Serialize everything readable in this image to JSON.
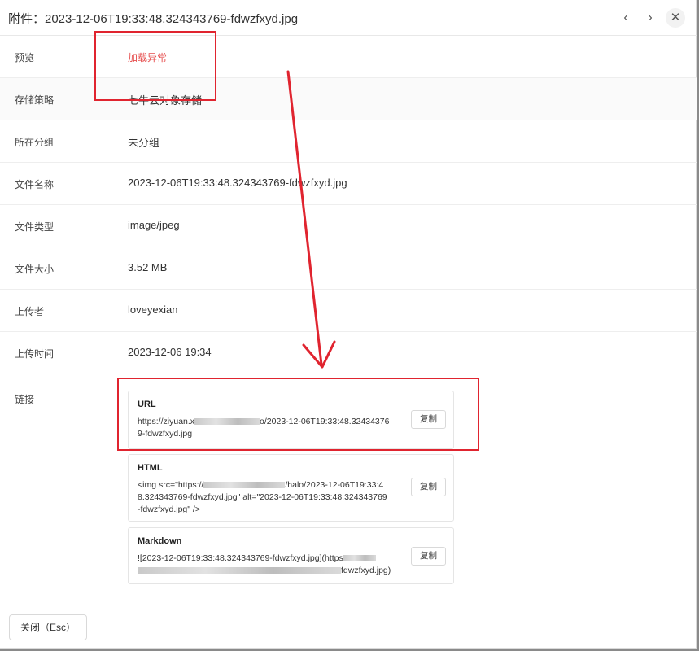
{
  "header": {
    "title": "附件：2023-12-06T19:33:48.324343769-fdwzfxyd.jpg",
    "prev_icon": "‹",
    "next_icon": "›",
    "close_icon": "✕"
  },
  "rows": [
    {
      "label": "预览",
      "value": "加载异常"
    },
    {
      "label": "存储策略",
      "value": "七牛云对象存储"
    },
    {
      "label": "所在分组",
      "value": "未分组"
    },
    {
      "label": "文件名称",
      "value": "2023-12-06T19:33:48.324343769-fdwzfxyd.jpg"
    },
    {
      "label": "文件类型",
      "value": "image/jpeg"
    },
    {
      "label": "文件大小",
      "value": "3.52 MB"
    },
    {
      "label": "上传者",
      "value": "loveyexian"
    },
    {
      "label": "上传时间",
      "value": "2023-12-06 19:34"
    }
  ],
  "links": {
    "label": "链接",
    "url": {
      "title": "URL",
      "prefix": "https://ziyuan.x",
      "suffix": "o/2023-12-06T19:33:48.32434376",
      "line2": "9-fdwzfxyd.jpg",
      "copy": "复制"
    },
    "html": {
      "title": "HTML",
      "prefix": "<img src=\"https://",
      "suffix": "/halo/2023-12-06T19:33:4",
      "line2": "8.324343769-fdwzfxyd.jpg\" alt=\"2023-12-06T19:33:48.324343769",
      "line3": "-fdwzfxyd.jpg\" />",
      "copy": "复制"
    },
    "markdown": {
      "title": "Markdown",
      "line1": "![2023-12-06T19:33:48.324343769-fdwzfxyd.jpg](https",
      "suffix": "fdwzfxyd.jpg)",
      "copy": "复制"
    }
  },
  "footer": {
    "close_label": "关闭（Esc）"
  }
}
